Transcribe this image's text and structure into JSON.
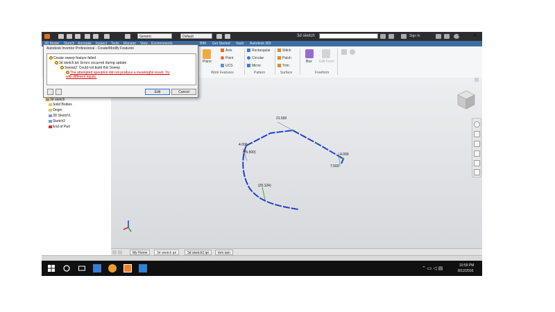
{
  "title_bar": {
    "style_dropdown": "Generic",
    "appearance_dropdown": "Default",
    "document_title": "3d sketch",
    "sign_in": "Sign In",
    "minimize": "─",
    "close": "✕"
  },
  "ribbon": {
    "tabs": [
      "3D Model",
      "Sketch",
      "Annotate",
      "Inspect",
      "Tools",
      "Manage",
      "View",
      "Environments",
      "BIM",
      "Get Started",
      "Vault",
      "Autodesk 360"
    ],
    "buttons": {
      "plane": "Plane",
      "axis": "Axis",
      "point": "Point",
      "ucs": "UCS",
      "rectangular": "Rectangular",
      "circular": "Circular",
      "mirror": "Mirror",
      "stitch": "Stitch",
      "patch": "Patch",
      "trim": "Trim",
      "box": "Box",
      "edit_form": "Edit Form"
    },
    "groups": {
      "work_features": "Work Features",
      "pattern": "Pattern",
      "surface": "Surface",
      "freeform": "Freeform"
    }
  },
  "dialog": {
    "title": "Autodesk Inventor Professional - Create/Modify Features",
    "rows": [
      "Create sweep feature failed",
      "3d sketch.ipt: Errors occurred during update",
      "Sweep2: Could not build this Sweep",
      "The attempted operation did not produce a meaningful result. Try with different inputs."
    ],
    "edit_button": "Edit",
    "cancel_button": "Cancel"
  },
  "browser": {
    "items": [
      "3d sketch",
      "Solid Bodies",
      "Origin",
      "3D Sketch1",
      "Sketch2",
      "End of Part"
    ]
  },
  "viewport": {
    "dimensions": [
      "21.500",
      "4.000",
      "(25.500)",
      "4.000",
      "7.500",
      "(25.124)"
    ],
    "path_color": "#1f3fcf"
  },
  "doc_tabs": [
    "My Home",
    "3d sketch.ipt",
    "3d sketch2.ipt",
    "trim.iam"
  ],
  "taskbar": {
    "time": "10:59 PM",
    "date": "8/12/2016"
  }
}
